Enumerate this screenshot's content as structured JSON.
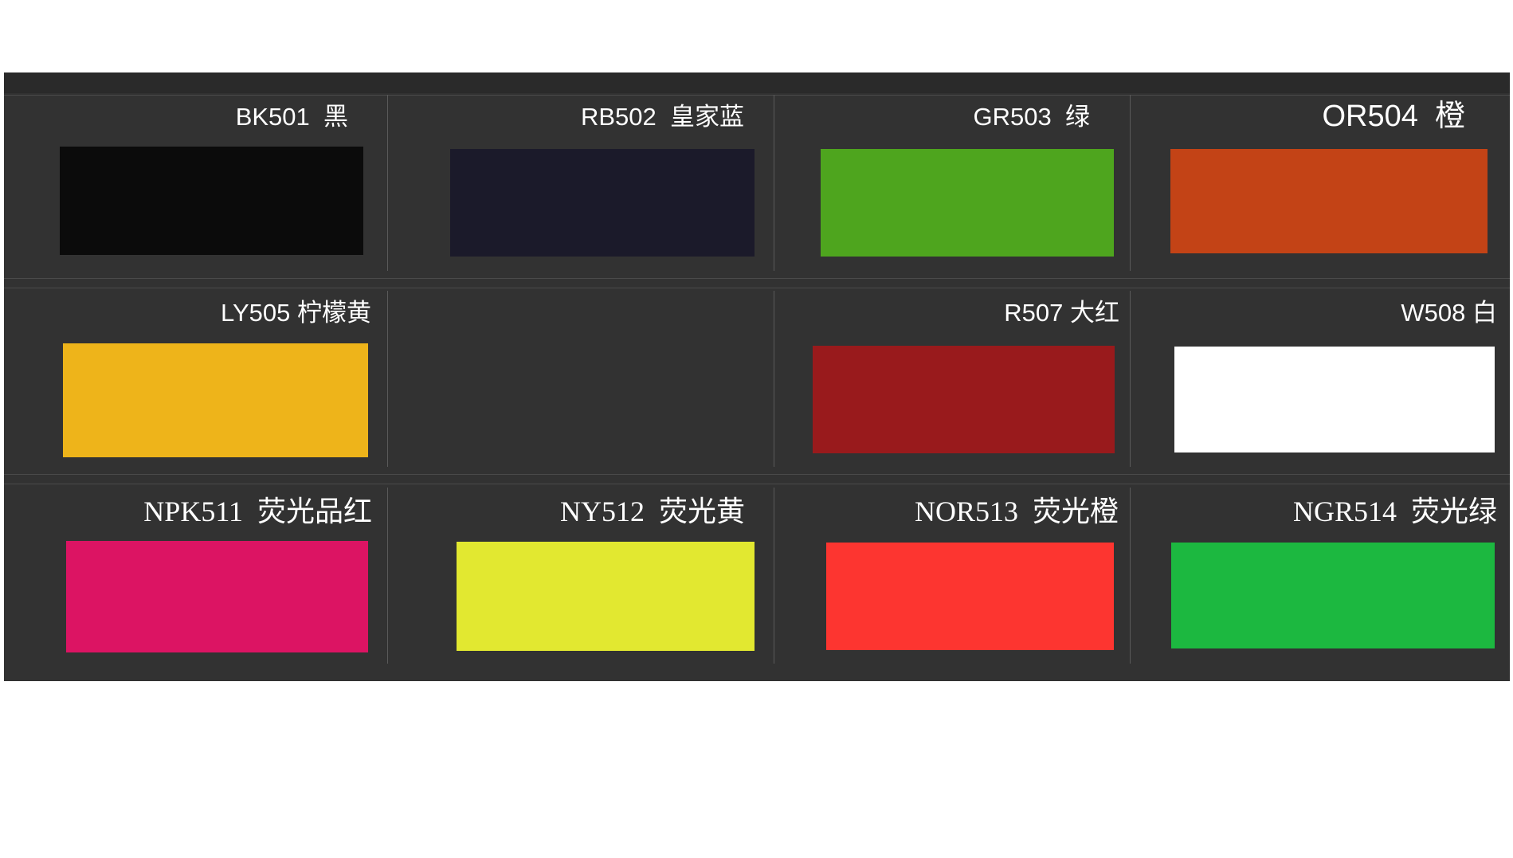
{
  "swatches": [
    {
      "code": "BK501",
      "name": "黑",
      "color": "#0b0b0b",
      "font": "sans"
    },
    {
      "code": "RB502",
      "name": "皇家蓝",
      "color": "#1b1a2a",
      "font": "sans"
    },
    {
      "code": "GR503",
      "name": "绿",
      "color": "#4ea51e",
      "font": "sans"
    },
    {
      "code": "OR504",
      "name": "橙",
      "color": "#c34316",
      "font": "sans"
    },
    {
      "code": "LY505",
      "name": "柠檬黄",
      "color": "#eeb41a",
      "font": "sans"
    },
    {
      "code": "R507",
      "name": "大红",
      "color": "#991a1c",
      "font": "sans"
    },
    {
      "code": "W508",
      "name": "白",
      "color": "#ffffff",
      "font": "sans"
    },
    {
      "code": "NPK511",
      "name": "荧光品红",
      "color": "#dc1463",
      "font": "serif"
    },
    {
      "code": "NY512",
      "name": "荧光黄",
      "color": "#e2e830",
      "font": "serif"
    },
    {
      "code": "NOR513",
      "name": "荧光橙",
      "color": "#fd3530",
      "font": "serif"
    },
    {
      "code": "NGR514",
      "name": "荧光绿",
      "color": "#1cb840",
      "font": "serif"
    }
  ]
}
